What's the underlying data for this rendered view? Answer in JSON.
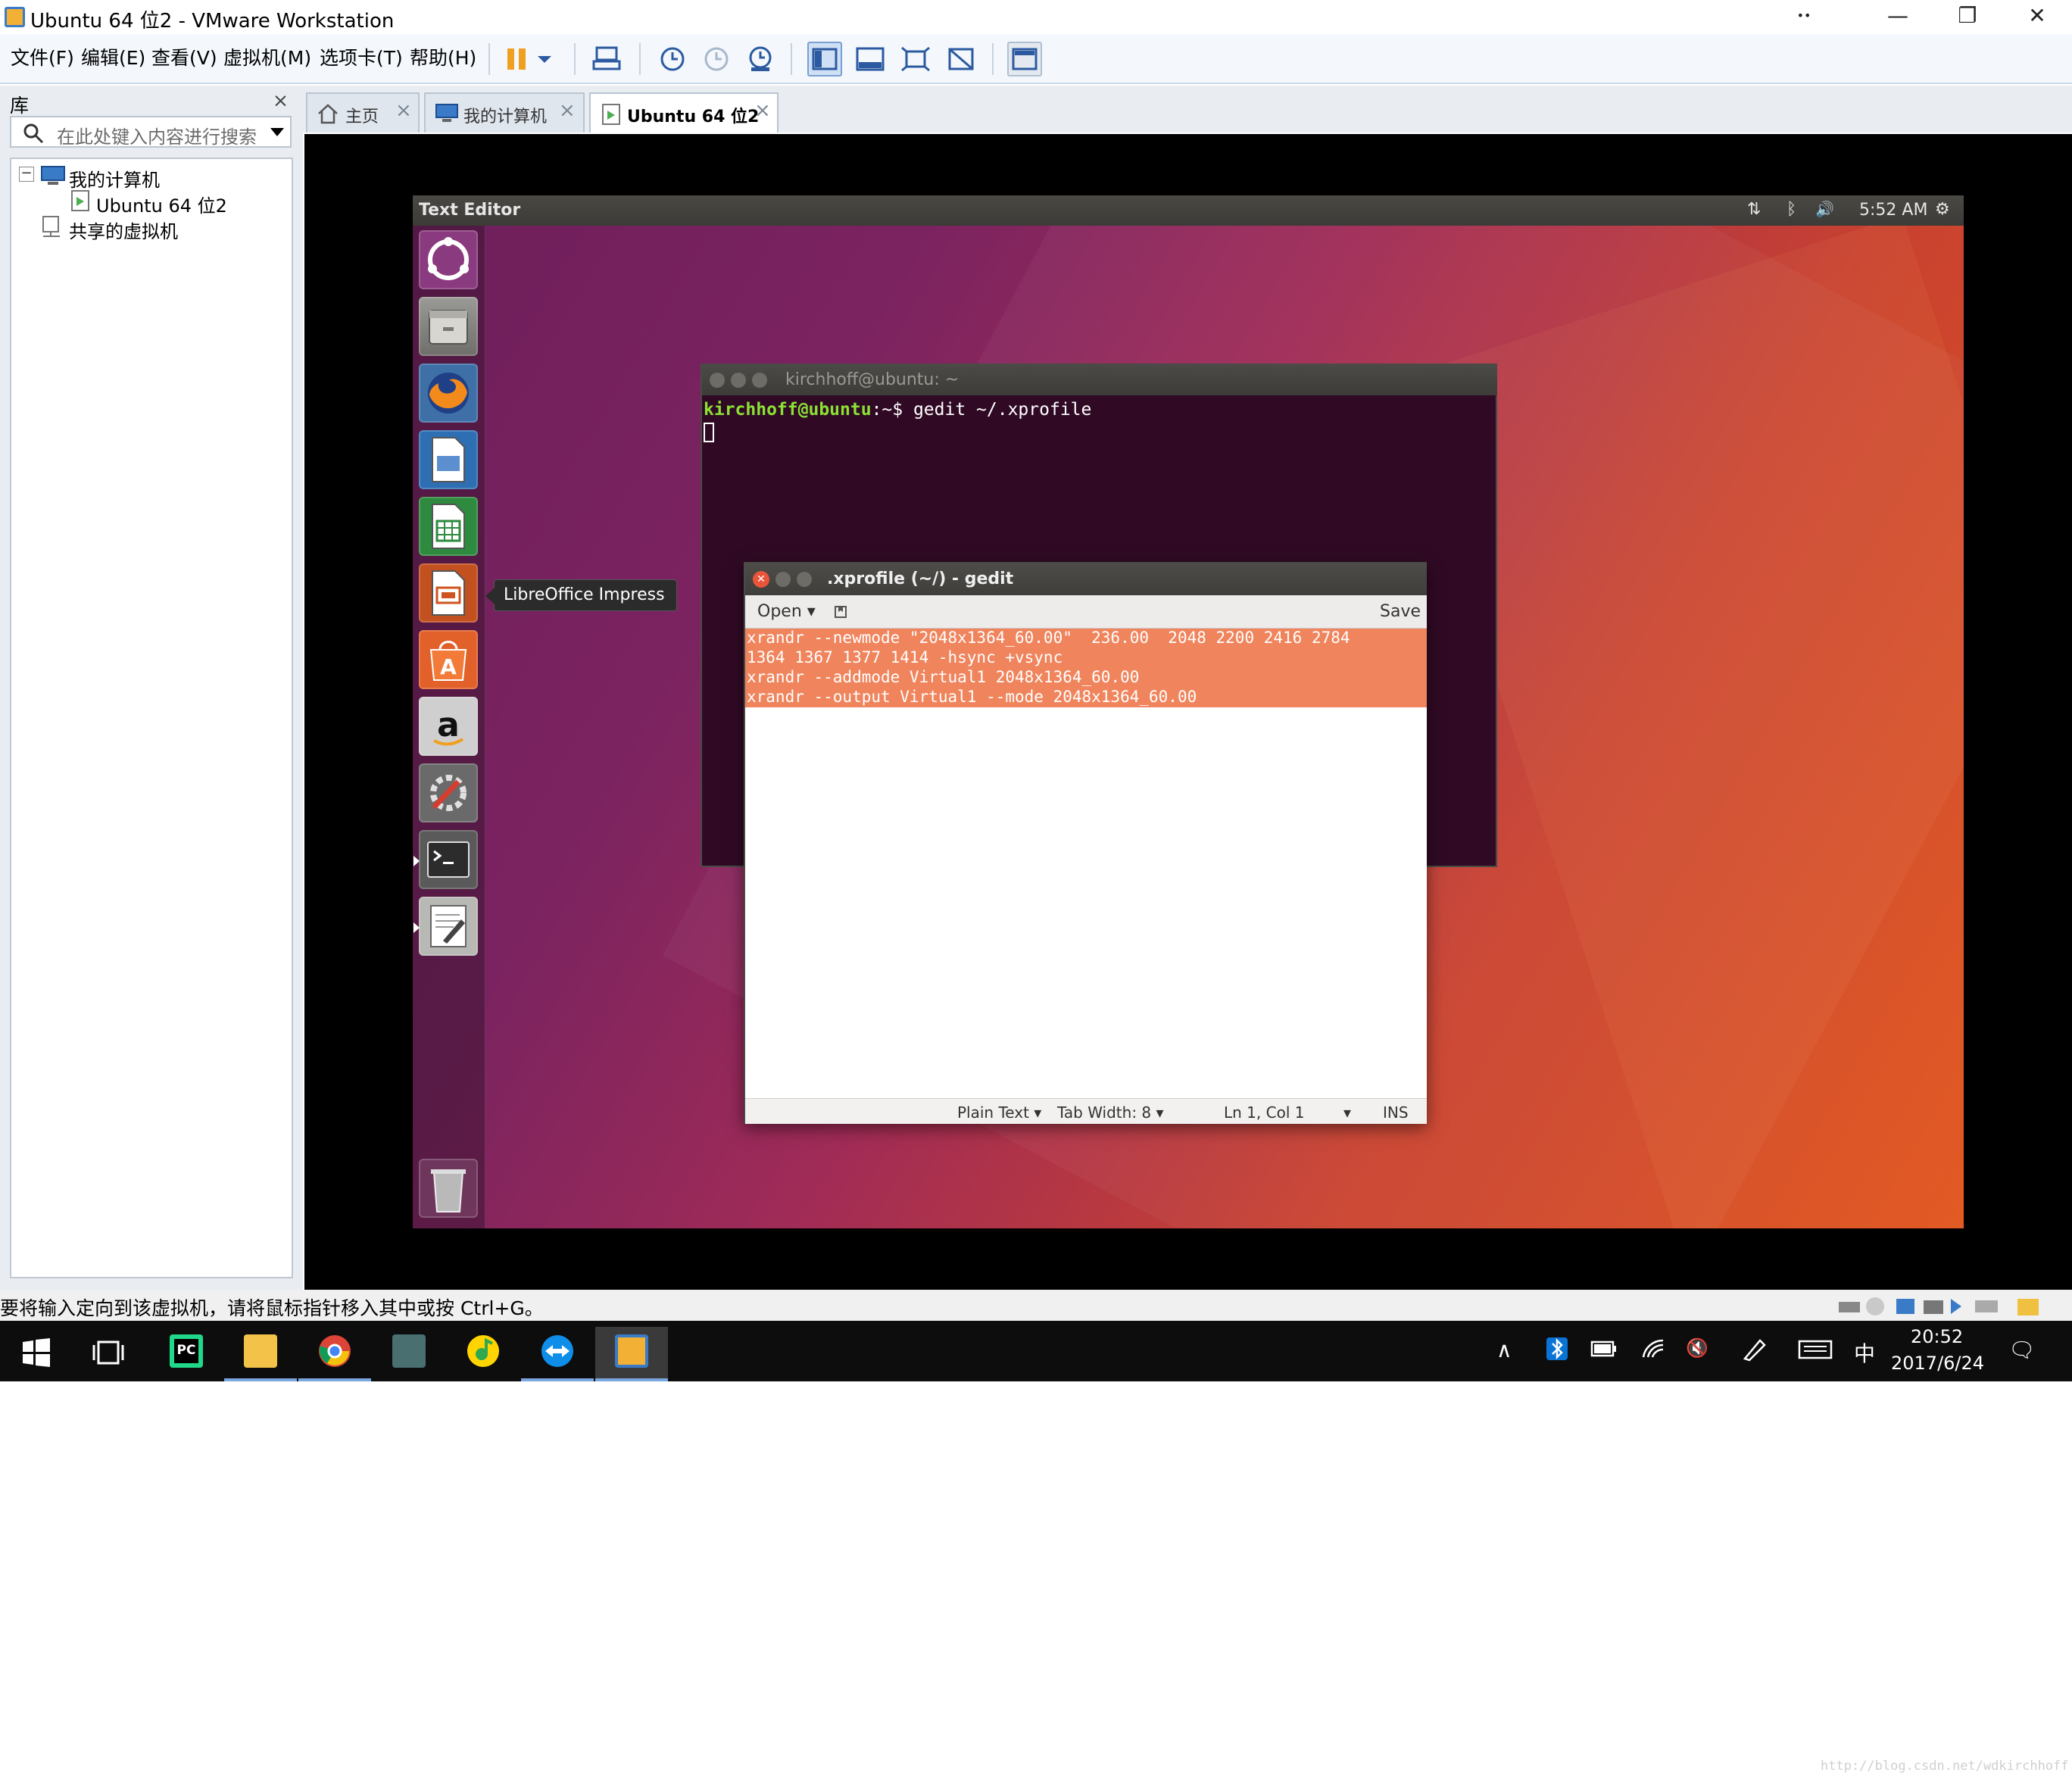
{
  "window": {
    "title": "Ubuntu 64 位2 - VMware Workstation",
    "pin_glyph": "••",
    "minimize": "—",
    "restore": "❐",
    "close": "✕"
  },
  "menu": {
    "items": [
      "文件(F)",
      "编辑(E)",
      "查看(V)",
      "虚拟机(M)",
      "选项卡(T)",
      "帮助(H)"
    ]
  },
  "library": {
    "title": "库",
    "close": "×",
    "search_placeholder": "在此处键入内容进行搜索",
    "tree": {
      "expander": "−",
      "my_computer": "我的计算机",
      "vm": "Ubuntu 64 位2",
      "shared": "共享的虚拟机"
    }
  },
  "tabs": [
    {
      "label": "主页",
      "close": "×"
    },
    {
      "label": "我的计算机",
      "close": "×"
    },
    {
      "label": "Ubuntu 64 位2",
      "close": "×"
    }
  ],
  "ubuntu": {
    "panel": {
      "title": "Text Editor",
      "clock": "5:52 AM",
      "net": "⇅",
      "bt": "ᛒ",
      "vol": "🔊",
      "gear": "⚙"
    },
    "launcher": {
      "tooltip": "LibreOffice Impress"
    },
    "terminal": {
      "title": "kirchhoff@ubuntu: ~",
      "prompt": "kirchhoff@ubuntu",
      "path": ":~$",
      "command": " gedit ~/.xprofile"
    },
    "gedit": {
      "title": ".xprofile (~/) - gedit",
      "open": "Open ▾",
      "save": "Save",
      "lines": [
        "xrandr --newmode \"2048x1364_60.00\"  236.00  2048 2200 2416 2784",
        "1364 1367 1377 1414 -hsync +vsync",
        "xrandr --addmode Virtual1 2048x1364_60.00",
        "xrandr --output Virtual1 --mode 2048x1364_60.00"
      ],
      "status": {
        "lang": "Plain Text ▾",
        "tab": "Tab Width: 8 ▾",
        "pos": "Ln 1, Col 1",
        "dd": "▾",
        "ins": "INS"
      }
    }
  },
  "statusbar": {
    "text": "要将输入定向到该虚拟机，请将鼠标指针移入其中或按 Ctrl+G。"
  },
  "taskbar": {
    "time": "20:52",
    "date": "2017/6/24",
    "ime": "中",
    "pc_label": "PC",
    "tray": {
      "chev": "∧",
      "sound": "🔇",
      "notif": "🗨"
    }
  },
  "watermark": "http://blog.csdn.net/wdkirchhoff",
  "colors": {
    "accent": "#3a7bc8",
    "selection": "#f0845c",
    "terminal_bg": "#300a24",
    "prompt": "#8ae234"
  }
}
